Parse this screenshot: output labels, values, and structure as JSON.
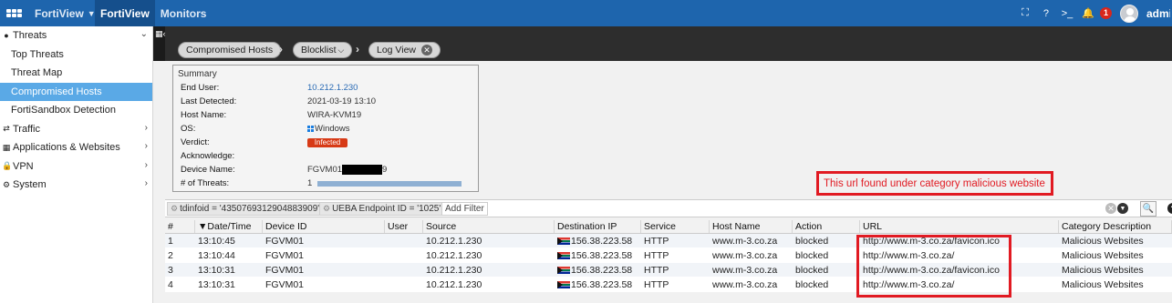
{
  "topbar": {
    "nav": [
      {
        "label": "FortiView",
        "has_dropdown": true
      },
      {
        "label": "FortiView",
        "active": true
      },
      {
        "label": "Monitors"
      }
    ],
    "notifications_count": "1",
    "user": "admi"
  },
  "sidebar": {
    "groups": [
      {
        "label": "Threats",
        "icon": "flame-icon",
        "expanded": true,
        "items": [
          "Top Threats",
          "Threat Map",
          "Compromised Hosts",
          "FortiSandbox Detection"
        ],
        "selected": "Compromised Hosts"
      },
      {
        "label": "Traffic",
        "icon": "traffic-icon"
      },
      {
        "label": "Applications & Websites",
        "icon": "apps-grid-icon"
      },
      {
        "label": "VPN",
        "icon": "lock-icon"
      },
      {
        "label": "System",
        "icon": "gear-icon"
      }
    ]
  },
  "breadcrumb": [
    "Compromised Hosts",
    "Blocklist",
    "Log View"
  ],
  "summary": {
    "title": "Summary",
    "end_user_label": "End User:",
    "end_user": "10.212.1.230",
    "last_detected_label": "Last Detected:",
    "last_detected": "2021-03-19 13:10",
    "host_name_label": "Host Name:",
    "host_name": "WIRA-KVM19",
    "os_label": "OS:",
    "os": "Windows",
    "verdict_label": "Verdict:",
    "verdict": "Infected",
    "acknowledge_label": "Acknowledge:",
    "device_name_label": "Device Name:",
    "device_name_prefix": "FGVM01",
    "device_name_suffix": "9",
    "threats_label": "# of Threats:",
    "threats": "1"
  },
  "annotation": "This url found under category malicious website",
  "filters": {
    "tags": [
      "tdinfoid = '4350769312904883909'",
      "UEBA Endpoint ID = '1025'"
    ],
    "add_label": "Add Filter"
  },
  "table": {
    "columns": [
      "#",
      "▼Date/Time",
      "Device ID",
      "User",
      "Source",
      "Destination IP",
      "Service",
      "Host Name",
      "Action",
      "URL",
      "Category Description"
    ],
    "rows": [
      {
        "n": "1",
        "time": "13:10:45",
        "device": "FGVM01",
        "user": "",
        "source": "10.212.1.230",
        "dest": "156.38.223.58",
        "service": "HTTP",
        "host": "www.m-3.co.za",
        "action": "blocked",
        "url": "http://www.m-3.co.za/favicon.ico",
        "category": "Malicious Websites"
      },
      {
        "n": "2",
        "time": "13:10:44",
        "device": "FGVM01",
        "user": "",
        "source": "10.212.1.230",
        "dest": "156.38.223.58",
        "service": "HTTP",
        "host": "www.m-3.co.za",
        "action": "blocked",
        "url": "http://www.m-3.co.za/",
        "category": "Malicious Websites"
      },
      {
        "n": "3",
        "time": "13:10:31",
        "device": "FGVM01",
        "user": "",
        "source": "10.212.1.230",
        "dest": "156.38.223.58",
        "service": "HTTP",
        "host": "www.m-3.co.za",
        "action": "blocked",
        "url": "http://www.m-3.co.za/favicon.ico",
        "category": "Malicious Websites"
      },
      {
        "n": "4",
        "time": "13:10:31",
        "device": "FGVM01",
        "user": "",
        "source": "10.212.1.230",
        "dest": "156.38.223.58",
        "service": "HTTP",
        "host": "www.m-3.co.za",
        "action": "blocked",
        "url": "http://www.m-3.co.za/",
        "category": "Malicious Websites"
      }
    ]
  },
  "colors": {
    "topbar": "#1e65ad",
    "selected": "#5aa9e6",
    "annotation": "#e11a22",
    "infected": "#d73a16"
  }
}
